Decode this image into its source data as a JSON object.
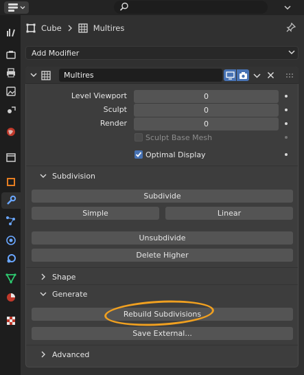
{
  "header": {
    "search_placeholder": "",
    "icons": [
      "editor-type-icon",
      "search-icon",
      "options-chevron-icon"
    ]
  },
  "tabs": [
    "tool",
    "render",
    "output",
    "view-layer",
    "scene",
    "world",
    "collection",
    "object",
    "modifiers",
    "particles",
    "physics",
    "constraints",
    "data",
    "material",
    "texture"
  ],
  "breadcrumb": {
    "object": "Cube",
    "modifier": "Multires"
  },
  "add_modifier": {
    "label": "Add Modifier"
  },
  "modifier": {
    "name": "Multires",
    "properties": [
      {
        "label": "Level Viewport",
        "value": "0"
      },
      {
        "label": "Sculpt",
        "value": "0"
      },
      {
        "label": "Render",
        "value": "0"
      }
    ],
    "sculpt_base_mesh": {
      "label": "Sculpt Base Mesh",
      "checked": false,
      "enabled": false
    },
    "optimal_display": {
      "label": "Optimal Display",
      "checked": true
    },
    "subdivision": {
      "title": "Subdivision",
      "subdivide": "Subdivide",
      "simple": "Simple",
      "linear": "Linear",
      "unsubdivide": "Unsubdivide",
      "delete_higher": "Delete Higher"
    },
    "shape": {
      "title": "Shape"
    },
    "generate": {
      "title": "Generate",
      "rebuild": "Rebuild Subdivisions",
      "save_external": "Save External..."
    },
    "advanced": {
      "title": "Advanced"
    }
  },
  "colors": {
    "accent": "#4772b3",
    "highlight_circle": "#f0a020",
    "panel": "#3d3d3d",
    "button": "#545454"
  }
}
